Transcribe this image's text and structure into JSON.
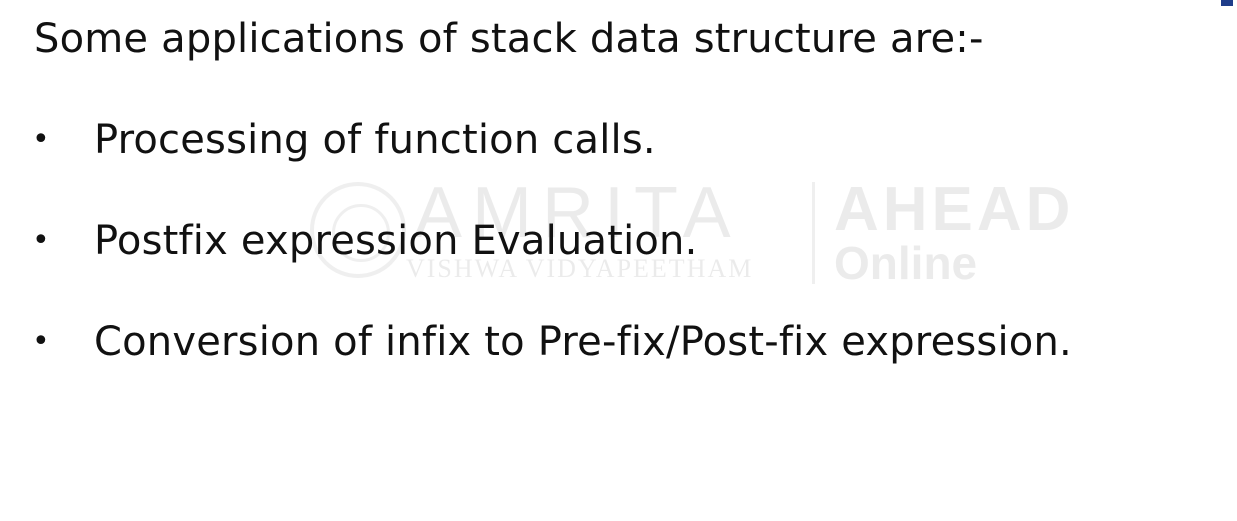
{
  "slide": {
    "title": "Some applications of stack data structure are:-",
    "bullet_symbol": "•",
    "bullets": [
      "Processing of function calls.",
      "Postfix expression Evaluation.",
      "Conversion of infix to Pre-fix/Post-fix expression."
    ]
  },
  "watermark": {
    "brand": "AMRITA",
    "institution": "VISHWA VIDYAPEETHAM",
    "program": "AHEAD",
    "mode": "Online"
  }
}
